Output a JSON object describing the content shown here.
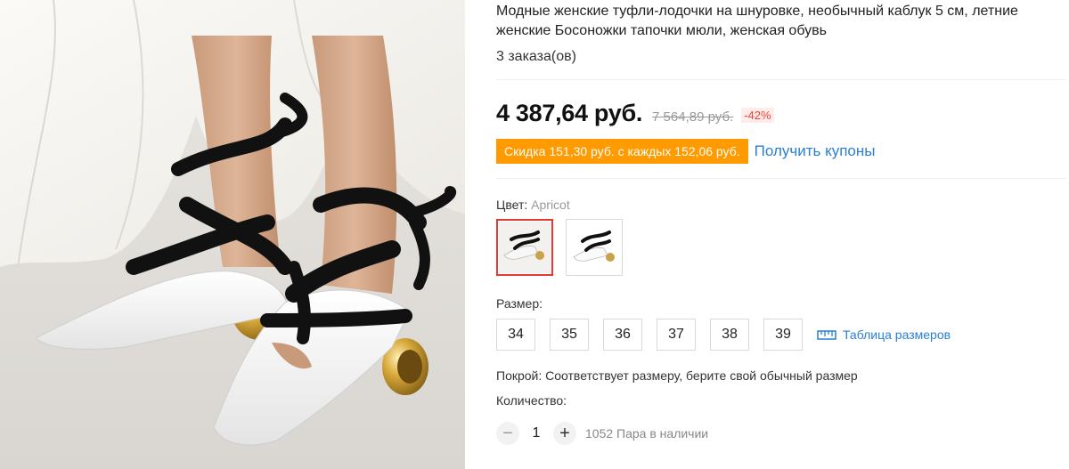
{
  "product": {
    "title": "Модные женские туфли-лодочки на шнуровке, необычный каблук 5 см, летние женские Босоножки тапочки мюли, женская обувь",
    "orders": "3 заказа(ов)"
  },
  "price": {
    "current": "4 387,64 руб.",
    "old": "7 564,89 руб.",
    "discount": "-42%"
  },
  "coupon": {
    "tag": "Скидка 151,30 руб. с каждых 152,06 руб.",
    "link": "Получить купоны"
  },
  "color": {
    "label": "Цвет:",
    "value": "Apricot",
    "options": [
      "black-white-shoe-thumb",
      "white-black-shoe-thumb"
    ]
  },
  "size": {
    "label": "Размер:",
    "options": [
      "34",
      "35",
      "36",
      "37",
      "38",
      "39"
    ],
    "table_link": "Таблица размеров"
  },
  "fit": "Покрой: Соответствует размеру, берите свой обычный размер",
  "quantity": {
    "label": "Количество:",
    "value": "1",
    "stock": "1052 Пара в наличии"
  },
  "colors": {
    "accent": "#e53935",
    "coupon_bg": "#ff9a00",
    "link": "#2a7fd4"
  }
}
